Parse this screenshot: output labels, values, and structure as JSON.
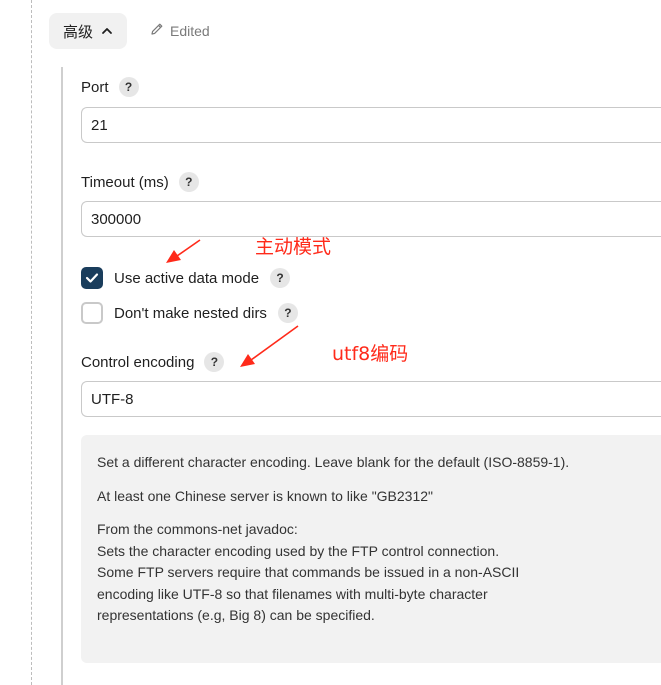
{
  "header": {
    "advanced_label": "高级",
    "edited_label": "Edited"
  },
  "fields": {
    "port": {
      "label": "Port",
      "value": "21"
    },
    "timeout": {
      "label": "Timeout (ms)",
      "value": "300000"
    },
    "active_mode": {
      "label": "Use active data mode",
      "checked": true
    },
    "nested_dirs": {
      "label": "Don't make nested dirs",
      "checked": false
    },
    "encoding": {
      "label": "Control encoding",
      "value": "UTF-8"
    }
  },
  "help_icon_text": "?",
  "help": {
    "p1": "Set a different character encoding. Leave blank for the default (ISO-8859-1).",
    "p2": "At least one Chinese server is known to like \"GB2312\"",
    "p3_lines": [
      "From the commons-net javadoc:",
      "Sets the character encoding used by the FTP control connection.",
      "Some FTP servers require that commands be issued in a non-ASCII",
      "encoding like UTF-8 so that filenames with multi-byte character",
      "representations (e.g, Big 8) can be specified."
    ]
  },
  "annotations": {
    "active_mode_note": "主动模式",
    "encoding_note": "utf8编码"
  },
  "colors": {
    "checkbox_checked": "#1a3d5c",
    "annotation_red": "#ff2a1a"
  }
}
